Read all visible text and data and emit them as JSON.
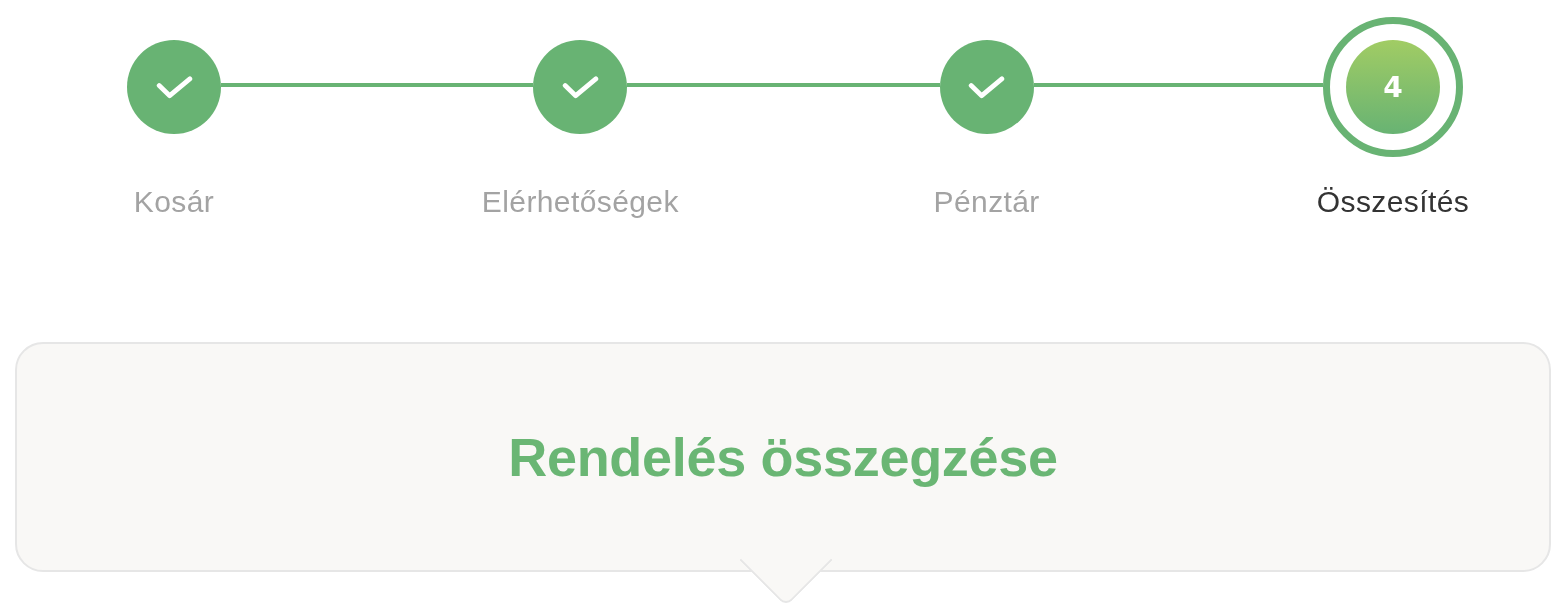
{
  "steps": [
    {
      "label": "Kosár",
      "completed": true,
      "current": false
    },
    {
      "label": "Elérhetőségek",
      "completed": true,
      "current": false
    },
    {
      "label": "Pénztár",
      "completed": true,
      "current": false
    },
    {
      "label": "Összesítés",
      "completed": false,
      "current": true,
      "number": "4"
    }
  ],
  "summary": {
    "title": "Rendelés összegzése"
  }
}
